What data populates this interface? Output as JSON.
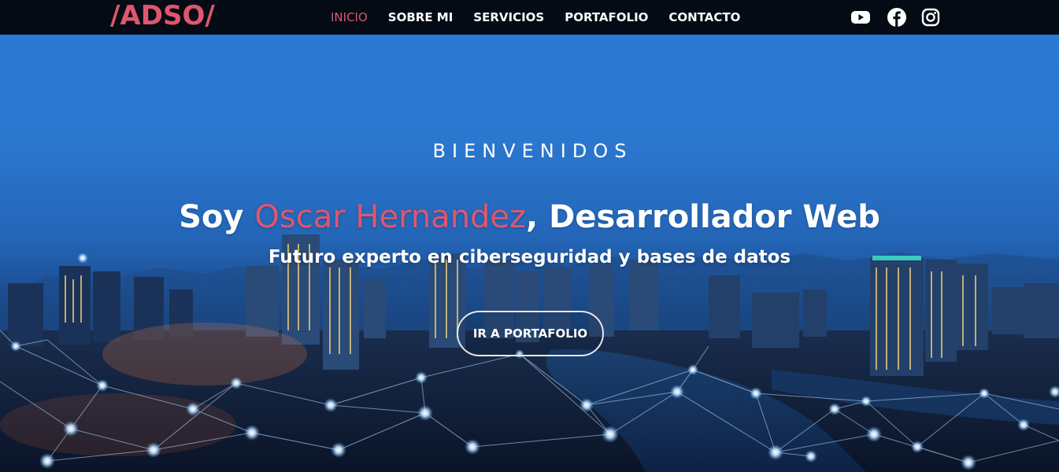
{
  "brand": {
    "logo": "/ADSO/"
  },
  "nav": {
    "items": [
      {
        "label": "INICIO",
        "active": true
      },
      {
        "label": "SOBRE MI",
        "active": false
      },
      {
        "label": "SERVICIOS",
        "active": false
      },
      {
        "label": "PORTAFOLIO",
        "active": false
      },
      {
        "label": "CONTACTO",
        "active": false
      }
    ],
    "social": [
      "youtube-icon",
      "facebook-icon",
      "instagram-icon"
    ]
  },
  "hero": {
    "pre": "BIENVENIDOS",
    "title_prefix": "Soy ",
    "title_name": "Oscar Hernandez",
    "title_suffix": ", Desarrollador Web",
    "subtitle": "Futuro experto en ciberseguridad y bases de datos",
    "cta_label": "IR A PORTAFOLIO"
  },
  "colors": {
    "accent": "#e0566e",
    "navbar_bg": "#040b14",
    "sky": "#2a7ad4"
  }
}
